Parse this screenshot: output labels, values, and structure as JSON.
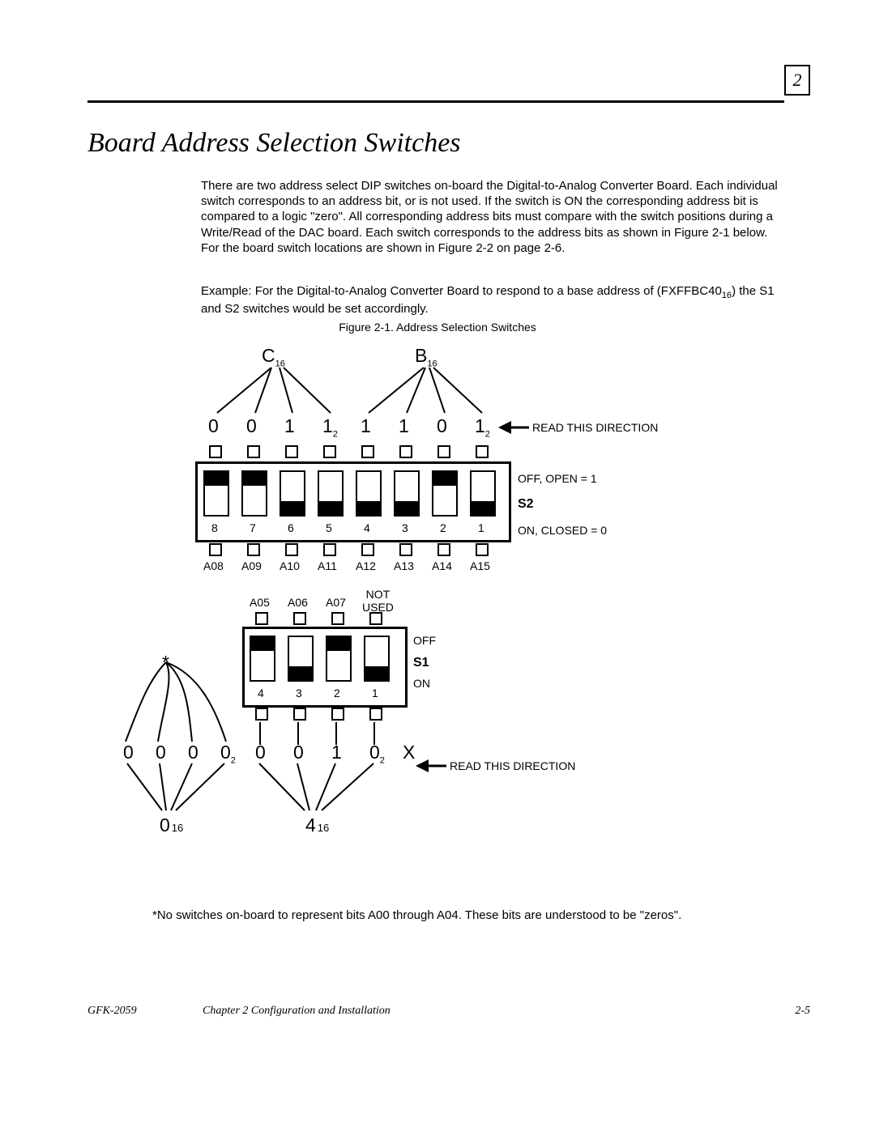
{
  "page_number_box": "2",
  "section_title": "Board Address Selection Switches",
  "para1": "There are two address select DIP switches on-board the Digital-to-Analog Converter Board. Each individual switch corresponds to an address bit, or is not used. If the switch is ON the corresponding address bit is compared to a logic \"zero\". All corresponding address bits must compare with the switch positions during a Write/Read of the DAC board. Each switch corresponds to the address bits as shown in Figure 2-1 below. For the board switch locations are shown in Figure 2-2 on page 2-6.",
  "para2_pre": "Example: For the Digital-to-Analog Converter Board to respond to a base address of (FXFFBC40",
  "para2_sub": "16",
  "para2_post": ") the S1 and S2 switches would be set accordingly.",
  "figure_caption": "Figure 2-1. Address Selection Switches",
  "figure": {
    "top_hex_C": "C",
    "top_hex_C_sub": "16",
    "top_hex_B": "B",
    "top_hex_B_sub": "16",
    "s2_bits": [
      "0",
      "0",
      "1",
      "1",
      "1",
      "1",
      "0",
      "1"
    ],
    "s2_bit_sub_idx3": "2",
    "s2_bit_sub_idx7": "2",
    "read_dir": "READ THIS DIRECTION",
    "off_open": "OFF, OPEN = 1",
    "on_closed": "ON, CLOSED = 0",
    "s2_name": "S2",
    "s2_nums": [
      "8",
      "7",
      "6",
      "5",
      "4",
      "3",
      "2",
      "1"
    ],
    "s2_addr": [
      "A08",
      "A09",
      "A10",
      "A11",
      "A12",
      "A13",
      "A14",
      "A15"
    ],
    "s1_top_lbls": [
      "A05",
      "A06",
      "A07",
      "NOT\nUSED"
    ],
    "s1_off": "OFF",
    "s1_on": "ON",
    "s1_name": "S1",
    "s1_nums": [
      "4",
      "3",
      "2",
      "1"
    ],
    "asterisk": "*",
    "bottom_bits": [
      "0",
      "0",
      "0",
      "0",
      "0",
      "0",
      "1",
      "0",
      "X"
    ],
    "bottom_sub_idx3": "2",
    "bottom_sub_idx7": "2",
    "bottom_hex_0": "0",
    "bottom_hex_0_sub": "16",
    "bottom_hex_4": "4",
    "bottom_hex_4_sub": "16",
    "read_dir2": "READ THIS DIRECTION"
  },
  "footnote": "*No switches on-board to represent bits A00 through A04.  These bits are understood to be \"zeros\".",
  "footer_left": "GFK-2059",
  "footer_center": "Chapter 2  Configuration and Installation",
  "footer_right": "2-5"
}
